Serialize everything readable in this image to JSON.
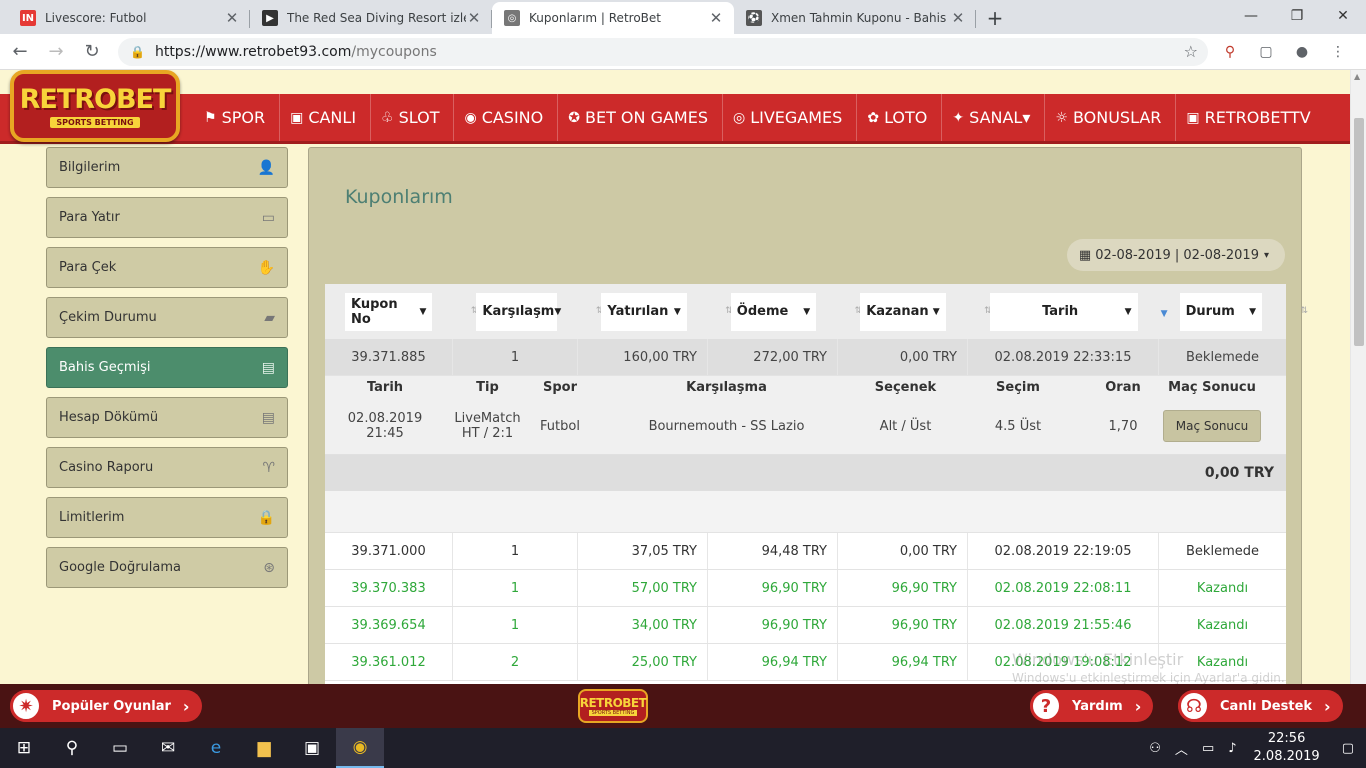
{
  "browser": {
    "tabs": [
      {
        "title": "Livescore: Futbol",
        "favicon": "IN",
        "color": "#e53935"
      },
      {
        "title": "The Red Sea Diving Resort izle - Fi",
        "favicon": "▶",
        "color": "#333333"
      },
      {
        "title": "Kuponlarım | RetroBet",
        "favicon": "◎",
        "color": "#777777"
      },
      {
        "title": "Xmen Tahmin Kuponu - Bahis Lo",
        "favicon": "⚽",
        "color": "#555555"
      }
    ],
    "url_host": "https://www.retrobet93.com",
    "url_path": "/mycoupons"
  },
  "site": {
    "logo_text": "RETROBET",
    "logo_sub": "SPORTS BETTING",
    "nav": [
      {
        "label": "SPOR",
        "icon": "⚑"
      },
      {
        "label": "CANLI",
        "icon": "▣"
      },
      {
        "label": "SLOT",
        "icon": "♧"
      },
      {
        "label": "CASINO",
        "icon": "◉"
      },
      {
        "label": "BET ON GAMES",
        "icon": "✪"
      },
      {
        "label": "LIVEGAMES",
        "icon": "◎"
      },
      {
        "label": "LOTO",
        "icon": "✿"
      },
      {
        "label": "SANAL▾",
        "icon": "✦"
      },
      {
        "label": "BONUSLAR",
        "icon": "☼"
      },
      {
        "label": "RETROBETTV",
        "icon": "▣"
      }
    ]
  },
  "sidebar": {
    "items": [
      {
        "label": "Bilgilerim",
        "icon": "👤"
      },
      {
        "label": "Para Yatır",
        "icon": "▭"
      },
      {
        "label": "Para Çek",
        "icon": "✋"
      },
      {
        "label": "Çekim Durumu",
        "icon": "▰"
      },
      {
        "label": "Bahis Geçmişi",
        "icon": "▤"
      },
      {
        "label": "Hesap Dökümü",
        "icon": "▤"
      },
      {
        "label": "Casino Raporu",
        "icon": "♈"
      },
      {
        "label": "Limitlerim",
        "icon": "🔒"
      },
      {
        "label": "Google Doğrulama",
        "icon": "⊛"
      }
    ],
    "active_index": 4
  },
  "content": {
    "title": "Kuponlarım",
    "date_range": "02-08-2019 | 02-08-2019",
    "columns": [
      "Kupon No",
      "Karşılaşm",
      "Yatırılan",
      "Ödeme",
      "Kazanan",
      "Tarih",
      "Durum"
    ],
    "expanded_row": [
      "39.371.885",
      "1",
      "160,00 TRY",
      "272,00 TRY",
      "0,00 TRY",
      "02.08.2019 22:33:15",
      "Beklemede"
    ],
    "detail": {
      "headers": [
        "Tarih",
        "Tip",
        "Spor",
        "Karşılaşma",
        "Seçenek",
        "Seçim",
        "Oran",
        "Maç Sonucu"
      ],
      "row": {
        "date": "02.08.2019",
        "time": "21:45",
        "tip1": "LiveMatch",
        "tip2": "HT / 2:1",
        "sport": "Futbol",
        "match": "Bournemouth - SS Lazio",
        "option": "Alt / Üst",
        "choice": "4.5 Üst",
        "odds": "1,70",
        "result_btn": "Maç Sonucu"
      },
      "total": "0,00 TRY"
    },
    "rows": [
      {
        "cells": [
          "39.371.000",
          "1",
          "37,05 TRY",
          "94,48 TRY",
          "0,00 TRY",
          "02.08.2019 22:19:05",
          "Beklemede"
        ],
        "won": false
      },
      {
        "cells": [
          "39.370.383",
          "1",
          "57,00 TRY",
          "96,90 TRY",
          "96,90 TRY",
          "02.08.2019 22:08:11",
          "Kazandı"
        ],
        "won": true
      },
      {
        "cells": [
          "39.369.654",
          "1",
          "34,00 TRY",
          "96,90 TRY",
          "96,90 TRY",
          "02.08.2019 21:55:46",
          "Kazandı"
        ],
        "won": true
      },
      {
        "cells": [
          "39.361.012",
          "2",
          "25,00 TRY",
          "96,94 TRY",
          "96,94 TRY",
          "02.08.2019 19:08:12",
          "Kazandı"
        ],
        "won": true
      }
    ]
  },
  "watermark": {
    "line1": "Windows'u Etkinleştir",
    "line2": "Windows'u etkinleştirmek için Ayarlar'a gidin."
  },
  "footer": {
    "popular": "Popüler Oyunlar",
    "help": "Yardım",
    "support": "Canlı Destek"
  },
  "taskbar": {
    "time": "22:56",
    "date": "2.08.2019"
  }
}
